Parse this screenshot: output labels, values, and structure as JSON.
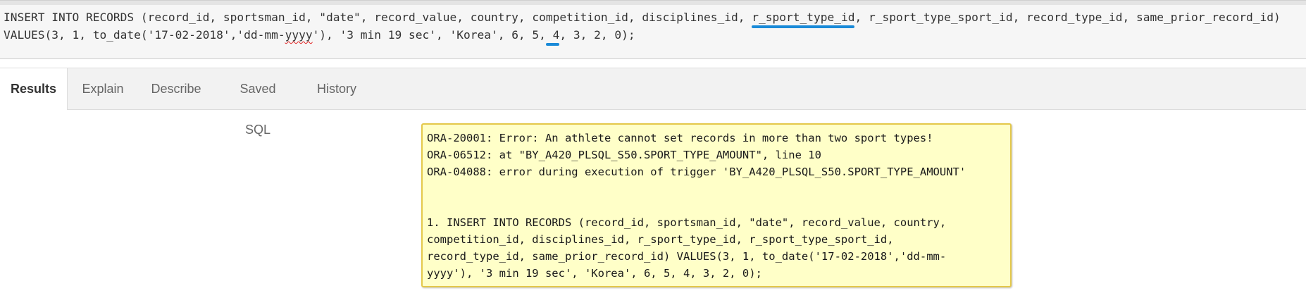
{
  "editor": {
    "line1": {
      "before": "INSERT INTO RECORDS (record_id, sportsman_id, \"date\", record_value, country, competition_id, disciplines_id, ",
      "highlight": "r_sport_type_id",
      "after": ", r_sport_type_sport_id, record_type_id, same_prior_record_id)"
    },
    "line2": {
      "before": "VALUES(3, 1, to_date('17-02-2018','dd-mm-",
      "misspelled": "yyyy",
      "middle": "'), '3 min 19 sec', 'Korea', 6, 5,",
      "highlight": " 4",
      "after": ", 3, 2, 0);"
    },
    "highlight_color": "#1a8ad8"
  },
  "tabs": [
    {
      "label": "Results",
      "active": true
    },
    {
      "label": "Explain",
      "active": false
    },
    {
      "label": "Describe",
      "active": false
    },
    {
      "label": "Saved SQL",
      "active": false
    },
    {
      "label": "History",
      "active": false
    }
  ],
  "error": {
    "messages": [
      "ORA-20001: Error: An athlete cannot set records in more than two sport types!",
      "ORA-06512: at \"BY_A420_PLSQL_S50.SPORT_TYPE_AMOUNT\", line 10",
      "ORA-04088: error during execution of trigger 'BY_A420_PLSQL_S50.SPORT_TYPE_AMOUNT'"
    ],
    "statement_lines": [
      "1. INSERT INTO RECORDS (record_id, sportsman_id, \"date\", record_value, country,",
      "competition_id, disciplines_id, r_sport_type_id, r_sport_type_sport_id,",
      "record_type_id, same_prior_record_id) VALUES(3, 1, to_date('17-02-2018','dd-mm-",
      "yyyy'), '3 min 19 sec', 'Korea', 6, 5, 4, 3, 2, 0);"
    ],
    "colors": {
      "background": "#ffffc8",
      "border": "#e4c84a"
    }
  }
}
